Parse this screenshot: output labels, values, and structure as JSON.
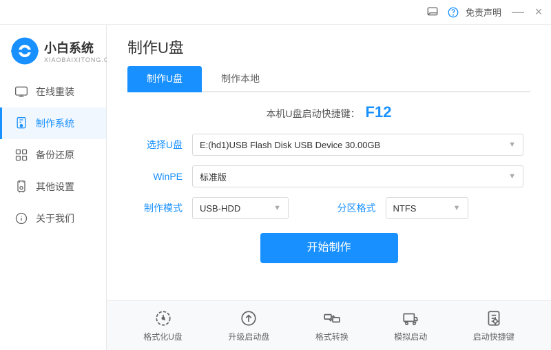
{
  "titlebar": {
    "feedback_label": "免责声明",
    "minimize_label": "—",
    "close_label": "×"
  },
  "sidebar": {
    "logo_main": "小白系统",
    "logo_sub": "XIAOBAIXITONG.COM",
    "items": [
      {
        "id": "online-reinstall",
        "label": "在线重装",
        "icon": "🖥"
      },
      {
        "id": "make-system",
        "label": "制作系统",
        "icon": "💾",
        "active": true
      },
      {
        "id": "backup-restore",
        "label": "备份还原",
        "icon": "🗂"
      },
      {
        "id": "other-settings",
        "label": "其他设置",
        "icon": "🔒"
      },
      {
        "id": "about-us",
        "label": "关于我们",
        "icon": "ℹ"
      }
    ]
  },
  "content": {
    "page_title": "制作U盘",
    "tabs": [
      {
        "id": "make-usb",
        "label": "制作U盘",
        "active": true
      },
      {
        "id": "make-local",
        "label": "制作本地",
        "active": false
      }
    ],
    "hotkey_hint": "本机U盘启动快捷键：",
    "hotkey_value": "F12",
    "form": {
      "usb_label": "选择U盘",
      "usb_value": "E:(hd1)USB Flash Disk USB Device 30.00GB",
      "winpe_label": "WinPE",
      "winpe_value": "标准版",
      "mode_label": "制作模式",
      "mode_value": "USB-HDD",
      "partition_label": "分区格式",
      "partition_value": "NTFS"
    },
    "start_button": "开始制作"
  },
  "toolbar": {
    "items": [
      {
        "id": "format-usb",
        "label": "格式化U盘"
      },
      {
        "id": "upgrade-boot",
        "label": "升级启动盘"
      },
      {
        "id": "format-convert",
        "label": "格式转换"
      },
      {
        "id": "simulate-boot",
        "label": "模拟启动"
      },
      {
        "id": "boot-shortcut",
        "label": "启动快捷键"
      }
    ]
  }
}
